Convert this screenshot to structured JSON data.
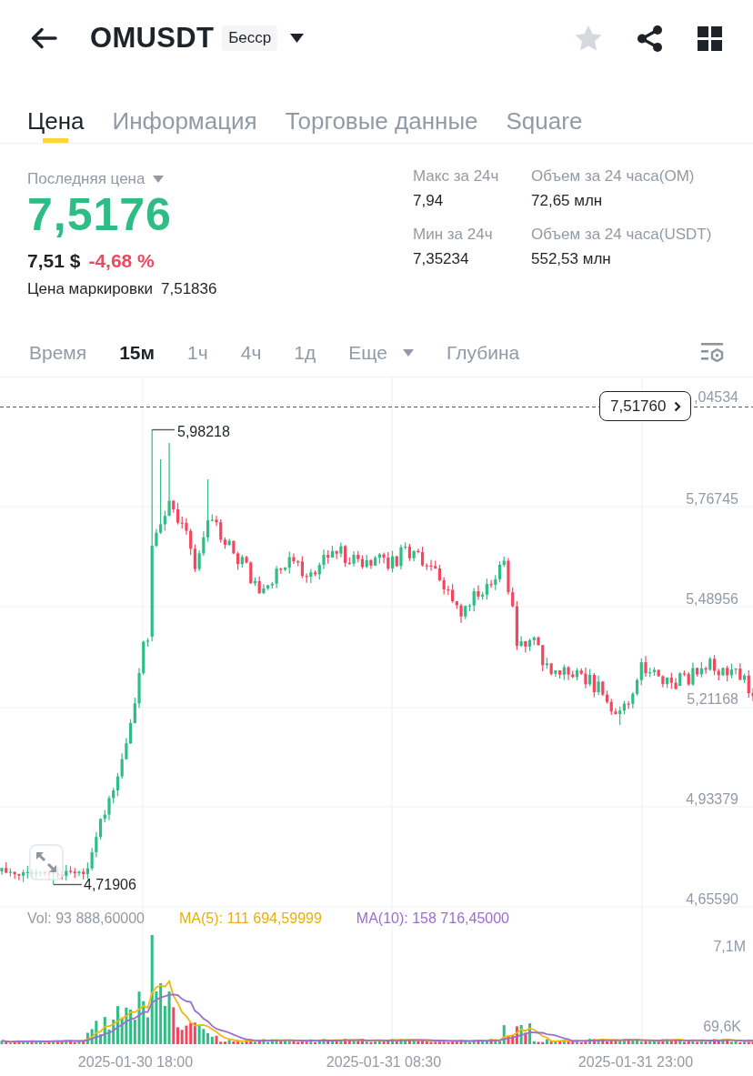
{
  "header": {
    "symbol": "OMUSDT",
    "badge": "Бесср"
  },
  "tabs": [
    {
      "label": "Цена",
      "selected": true
    },
    {
      "label": "Информация",
      "selected": false
    },
    {
      "label": "Торговые данные",
      "selected": false
    },
    {
      "label": "Square",
      "selected": false
    }
  ],
  "price": {
    "label": "Последняя цена",
    "last": "7,5176",
    "usd": "7,51 $",
    "change": "-4,68 %",
    "mark_label": "Цена маркировки",
    "mark_value": "7,51836"
  },
  "stats": [
    {
      "label": "Макс за 24ч",
      "value": "7,94"
    },
    {
      "label": "Объем за 24 часа(OM)",
      "value": "72,65 млн"
    },
    {
      "label": "Мин за 24ч",
      "value": "7,35234"
    },
    {
      "label": "Объем за 24 часа(USDT)",
      "value": "552,53 млн"
    }
  ],
  "intervals": [
    {
      "label": "Время",
      "kind": "tab",
      "selected": false
    },
    {
      "label": "15м",
      "kind": "tab",
      "selected": true
    },
    {
      "label": "1ч",
      "kind": "tab",
      "selected": false
    },
    {
      "label": "4ч",
      "kind": "tab",
      "selected": false
    },
    {
      "label": "1д",
      "kind": "tab",
      "selected": false
    },
    {
      "label": "Еще",
      "kind": "menu",
      "selected": false
    },
    {
      "label": "Глубина",
      "kind": "tab",
      "selected": false
    }
  ],
  "chart": {
    "price_ticks": [
      ",04534",
      "5,76745",
      "5,48956",
      "5,21168",
      "4,93379",
      "4,65590"
    ],
    "current_price": "7,51760",
    "high_label": "5,98218",
    "low_label": "4,71906"
  },
  "volume": {
    "vol": "Vol: 93 888,60000",
    "ma5": "MA(5): 111 694,59999",
    "ma10": "MA(10): 158 716,45000",
    "ticks": [
      "7,1M",
      "69,6K"
    ]
  },
  "time_labels": [
    "2025-01-30 18:00",
    "2025-01-31 08:30",
    "2025-01-31 23:00"
  ]
}
